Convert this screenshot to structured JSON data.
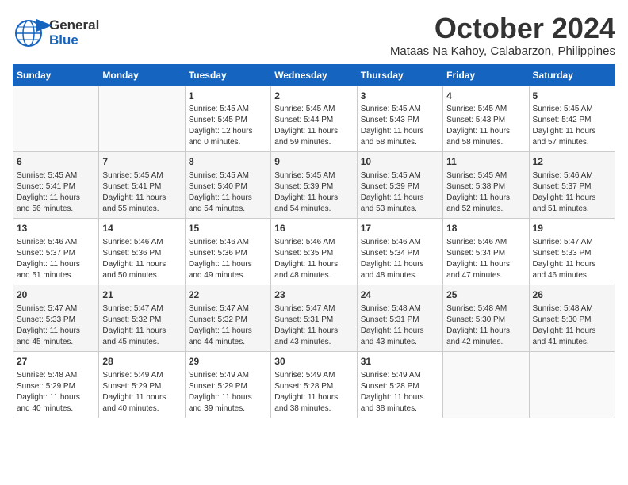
{
  "logo": {
    "line1": "General",
    "line2": "Blue"
  },
  "title": "October 2024",
  "location": "Mataas Na Kahoy, Calabarzon, Philippines",
  "days_of_week": [
    "Sunday",
    "Monday",
    "Tuesday",
    "Wednesday",
    "Thursday",
    "Friday",
    "Saturday"
  ],
  "weeks": [
    [
      {
        "day": "",
        "info": ""
      },
      {
        "day": "",
        "info": ""
      },
      {
        "day": "1",
        "info": "Sunrise: 5:45 AM\nSunset: 5:45 PM\nDaylight: 12 hours\nand 0 minutes."
      },
      {
        "day": "2",
        "info": "Sunrise: 5:45 AM\nSunset: 5:44 PM\nDaylight: 11 hours\nand 59 minutes."
      },
      {
        "day": "3",
        "info": "Sunrise: 5:45 AM\nSunset: 5:43 PM\nDaylight: 11 hours\nand 58 minutes."
      },
      {
        "day": "4",
        "info": "Sunrise: 5:45 AM\nSunset: 5:43 PM\nDaylight: 11 hours\nand 58 minutes."
      },
      {
        "day": "5",
        "info": "Sunrise: 5:45 AM\nSunset: 5:42 PM\nDaylight: 11 hours\nand 57 minutes."
      }
    ],
    [
      {
        "day": "6",
        "info": "Sunrise: 5:45 AM\nSunset: 5:41 PM\nDaylight: 11 hours\nand 56 minutes."
      },
      {
        "day": "7",
        "info": "Sunrise: 5:45 AM\nSunset: 5:41 PM\nDaylight: 11 hours\nand 55 minutes."
      },
      {
        "day": "8",
        "info": "Sunrise: 5:45 AM\nSunset: 5:40 PM\nDaylight: 11 hours\nand 54 minutes."
      },
      {
        "day": "9",
        "info": "Sunrise: 5:45 AM\nSunset: 5:39 PM\nDaylight: 11 hours\nand 54 minutes."
      },
      {
        "day": "10",
        "info": "Sunrise: 5:45 AM\nSunset: 5:39 PM\nDaylight: 11 hours\nand 53 minutes."
      },
      {
        "day": "11",
        "info": "Sunrise: 5:45 AM\nSunset: 5:38 PM\nDaylight: 11 hours\nand 52 minutes."
      },
      {
        "day": "12",
        "info": "Sunrise: 5:46 AM\nSunset: 5:37 PM\nDaylight: 11 hours\nand 51 minutes."
      }
    ],
    [
      {
        "day": "13",
        "info": "Sunrise: 5:46 AM\nSunset: 5:37 PM\nDaylight: 11 hours\nand 51 minutes."
      },
      {
        "day": "14",
        "info": "Sunrise: 5:46 AM\nSunset: 5:36 PM\nDaylight: 11 hours\nand 50 minutes."
      },
      {
        "day": "15",
        "info": "Sunrise: 5:46 AM\nSunset: 5:36 PM\nDaylight: 11 hours\nand 49 minutes."
      },
      {
        "day": "16",
        "info": "Sunrise: 5:46 AM\nSunset: 5:35 PM\nDaylight: 11 hours\nand 48 minutes."
      },
      {
        "day": "17",
        "info": "Sunrise: 5:46 AM\nSunset: 5:34 PM\nDaylight: 11 hours\nand 48 minutes."
      },
      {
        "day": "18",
        "info": "Sunrise: 5:46 AM\nSunset: 5:34 PM\nDaylight: 11 hours\nand 47 minutes."
      },
      {
        "day": "19",
        "info": "Sunrise: 5:47 AM\nSunset: 5:33 PM\nDaylight: 11 hours\nand 46 minutes."
      }
    ],
    [
      {
        "day": "20",
        "info": "Sunrise: 5:47 AM\nSunset: 5:33 PM\nDaylight: 11 hours\nand 45 minutes."
      },
      {
        "day": "21",
        "info": "Sunrise: 5:47 AM\nSunset: 5:32 PM\nDaylight: 11 hours\nand 45 minutes."
      },
      {
        "day": "22",
        "info": "Sunrise: 5:47 AM\nSunset: 5:32 PM\nDaylight: 11 hours\nand 44 minutes."
      },
      {
        "day": "23",
        "info": "Sunrise: 5:47 AM\nSunset: 5:31 PM\nDaylight: 11 hours\nand 43 minutes."
      },
      {
        "day": "24",
        "info": "Sunrise: 5:48 AM\nSunset: 5:31 PM\nDaylight: 11 hours\nand 43 minutes."
      },
      {
        "day": "25",
        "info": "Sunrise: 5:48 AM\nSunset: 5:30 PM\nDaylight: 11 hours\nand 42 minutes."
      },
      {
        "day": "26",
        "info": "Sunrise: 5:48 AM\nSunset: 5:30 PM\nDaylight: 11 hours\nand 41 minutes."
      }
    ],
    [
      {
        "day": "27",
        "info": "Sunrise: 5:48 AM\nSunset: 5:29 PM\nDaylight: 11 hours\nand 40 minutes."
      },
      {
        "day": "28",
        "info": "Sunrise: 5:49 AM\nSunset: 5:29 PM\nDaylight: 11 hours\nand 40 minutes."
      },
      {
        "day": "29",
        "info": "Sunrise: 5:49 AM\nSunset: 5:29 PM\nDaylight: 11 hours\nand 39 minutes."
      },
      {
        "day": "30",
        "info": "Sunrise: 5:49 AM\nSunset: 5:28 PM\nDaylight: 11 hours\nand 38 minutes."
      },
      {
        "day": "31",
        "info": "Sunrise: 5:49 AM\nSunset: 5:28 PM\nDaylight: 11 hours\nand 38 minutes."
      },
      {
        "day": "",
        "info": ""
      },
      {
        "day": "",
        "info": ""
      }
    ]
  ]
}
